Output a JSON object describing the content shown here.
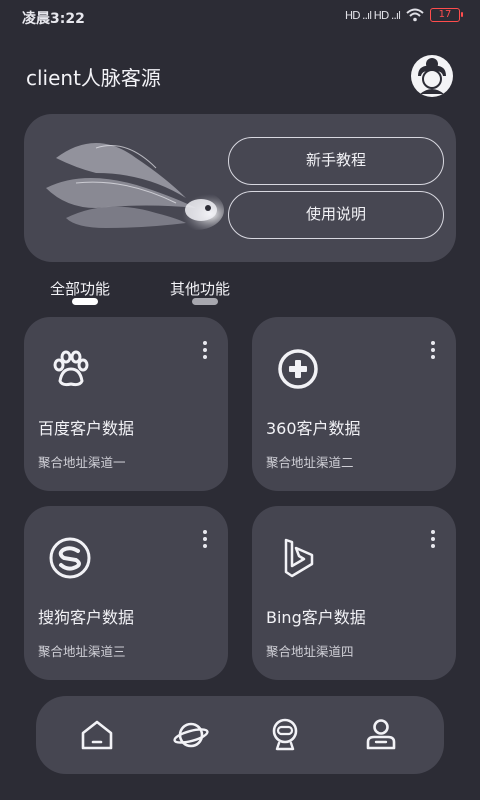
{
  "status_bar": {
    "time": "凌晨3:22",
    "signal": "HD ..ıl HD ..ıl",
    "battery": "17"
  },
  "header": {
    "title": "client人脉客源",
    "avatar_icon": "user-avatar-icon"
  },
  "hero": {
    "image_icon": "goldfish-illustration",
    "buttons": [
      "新手教程",
      "使用说明"
    ]
  },
  "tabs": [
    {
      "label": "全部功能",
      "active": true
    },
    {
      "label": "其他功能",
      "active": false
    }
  ],
  "cards": [
    {
      "title": "百度客户数据",
      "subtitle": "聚合地址渠道一",
      "icon": "baidu-paw-icon"
    },
    {
      "title": "360客户数据",
      "subtitle": "聚合地址渠道二",
      "icon": "360-icon"
    },
    {
      "title": "搜狗客户数据",
      "subtitle": "聚合地址渠道三",
      "icon": "sogou-icon"
    },
    {
      "title": "Bing客户数据",
      "subtitle": "聚合地址渠道四",
      "icon": "bing-icon"
    }
  ],
  "bottom_nav": {
    "items": [
      "home-icon",
      "planet-icon",
      "robot-icon",
      "profile-icon"
    ]
  },
  "colors": {
    "background": "#2c2c35",
    "card": "#454550",
    "accent": "#ffffff",
    "battery": "#ff4d4d"
  }
}
